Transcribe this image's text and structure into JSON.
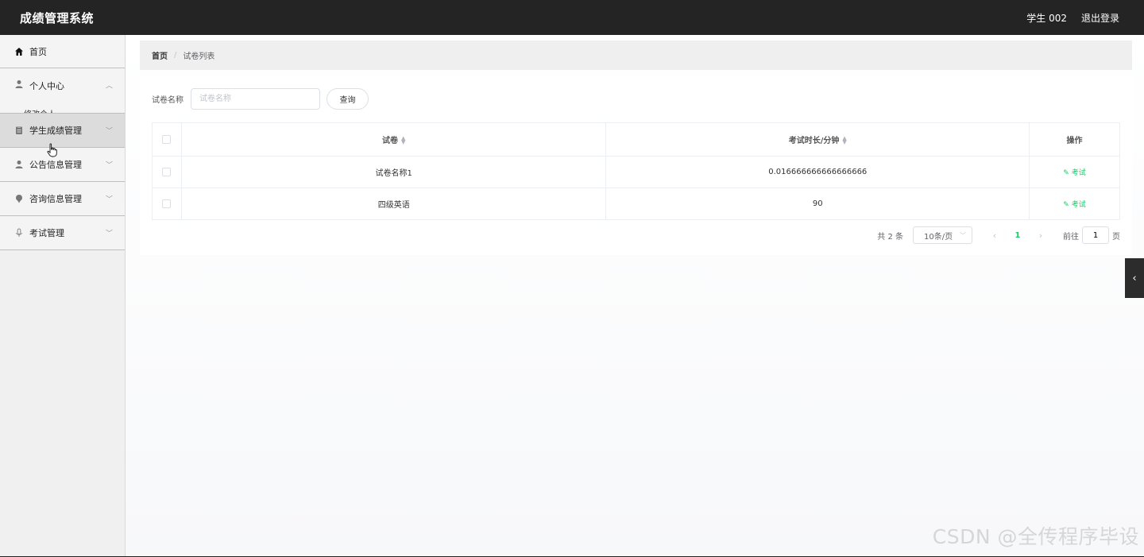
{
  "header": {
    "title": "成绩管理系统",
    "user": "学生 002",
    "logout": "退出登录"
  },
  "sidebar": {
    "items": [
      {
        "label": "首页",
        "icon": "home-icon"
      },
      {
        "label": "个人中心",
        "icon": "user-icon",
        "expanded": true,
        "peek": "修改个人"
      },
      {
        "label": "学生成绩管理",
        "icon": "clipboard-icon",
        "active": true
      },
      {
        "label": "公告信息管理",
        "icon": "user-icon"
      },
      {
        "label": "咨询信息管理",
        "icon": "pin-icon"
      },
      {
        "label": "考试管理",
        "icon": "mic-icon"
      }
    ]
  },
  "breadcrumb": {
    "home": "首页",
    "separator": "/",
    "current": "试卷列表"
  },
  "search": {
    "label": "试卷名称",
    "placeholder": "试卷名称",
    "value": "",
    "button": "查询"
  },
  "table": {
    "columns": [
      "试卷",
      "考试时长/分钟",
      "操作"
    ],
    "rows": [
      {
        "name": "试卷名称1",
        "duration": "0.016666666666666666",
        "action": "考试"
      },
      {
        "name": "四级英语",
        "duration": "90",
        "action": "考试"
      }
    ]
  },
  "pagination": {
    "total": "共 2 条",
    "page_size": "10条/页",
    "current_page": "1",
    "goto_prefix": "前往",
    "goto_value": "1",
    "goto_suffix": "页"
  },
  "watermark": "CSDN @全传程序毕设",
  "colors": {
    "accent": "#13ce66",
    "header_bg": "#242424",
    "sidebar_bg": "#f0f0f0"
  }
}
